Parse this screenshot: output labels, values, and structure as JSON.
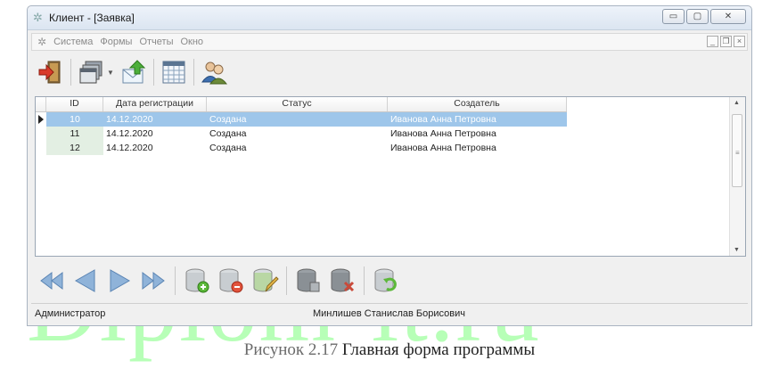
{
  "window": {
    "title": "Клиент - [Заявка]"
  },
  "menu": {
    "items": [
      "Система",
      "Формы",
      "Отчеты",
      "Окно"
    ]
  },
  "toolbar": {
    "icons": [
      "exit-icon",
      "windows-icon",
      "export-icon",
      "calendar-icon",
      "users-icon"
    ]
  },
  "grid": {
    "columns": [
      "ID",
      "Дата регистрации",
      "Статус",
      "Создатель"
    ],
    "rows": [
      {
        "id": "10",
        "date": "14.12.2020",
        "status": "Создана",
        "creator": "Иванова Анна Петровна",
        "selected": true
      },
      {
        "id": "11",
        "date": "14.12.2020",
        "status": "Создана",
        "creator": "Иванова Анна Петровна",
        "selected": false
      },
      {
        "id": "12",
        "date": "14.12.2020",
        "status": "Создана",
        "creator": "Иванова Анна Петровна",
        "selected": false
      }
    ]
  },
  "navigator": {
    "icons": [
      "first-icon",
      "prior-icon",
      "next-icon",
      "last-icon",
      "insert-icon",
      "delete-icon",
      "edit-icon",
      "post-icon",
      "cancel-icon",
      "refresh-icon"
    ]
  },
  "status": {
    "role": "Администратор",
    "user": "Минлишев Станислав Борисович"
  },
  "caption": {
    "label": "Рисунок 2.17",
    "text": "Главная форма программы"
  },
  "watermark": {
    "text": "Diplom-it.ru"
  },
  "colors": {
    "selection": "#9ec6ea",
    "watermark": "#7dff7d",
    "id_cell": "#e3efe3"
  }
}
